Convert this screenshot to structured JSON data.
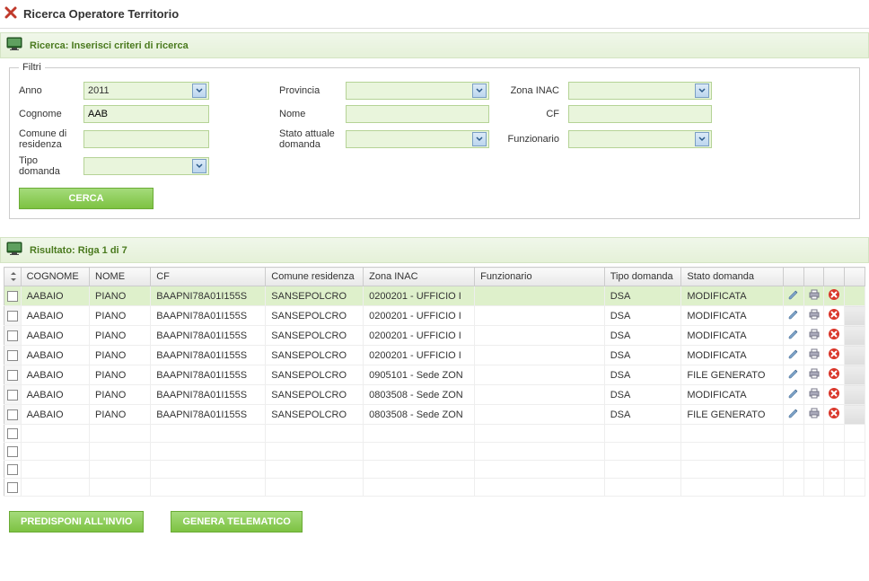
{
  "page": {
    "title": "Ricerca Operatore Territorio"
  },
  "search_section": {
    "title": "Ricerca: Inserisci criteri di ricerca"
  },
  "filters": {
    "legend": "Filtri",
    "anno": {
      "label": "Anno",
      "value": "2011"
    },
    "provincia": {
      "label": "Provincia",
      "value": ""
    },
    "zona_inac": {
      "label": "Zona INAC",
      "value": ""
    },
    "cognome": {
      "label": "Cognome",
      "value": "AAB"
    },
    "nome": {
      "label": "Nome",
      "value": ""
    },
    "cf": {
      "label": "CF",
      "value": ""
    },
    "comune_residenza": {
      "label": "Comune di residenza",
      "value": ""
    },
    "stato_attuale": {
      "label": "Stato attuale domanda",
      "value": ""
    },
    "funzionario": {
      "label": "Funzionario",
      "value": ""
    },
    "tipo_domanda": {
      "label": "Tipo domanda",
      "value": ""
    },
    "cerca_button": "CERCA"
  },
  "results_section": {
    "title": "Risultato: Riga 1 di 7"
  },
  "grid": {
    "columns": {
      "cognome": "COGNOME",
      "nome": "NOME",
      "cf": "CF",
      "comune": "Comune residenza",
      "zona": "Zona INAC",
      "funzionario": "Funzionario",
      "tipo": "Tipo domanda",
      "stato": "Stato domanda"
    },
    "rows": [
      {
        "cognome": "AABAIO",
        "nome": "PIANO",
        "cf": "BAAPNI78A01I155S",
        "comune": "SANSEPOLCRO",
        "zona": "0200201 - UFFICIO I",
        "funzionario": "",
        "tipo": "DSA",
        "stato": "MODIFICATA",
        "selected": true
      },
      {
        "cognome": "AABAIO",
        "nome": "PIANO",
        "cf": "BAAPNI78A01I155S",
        "comune": "SANSEPOLCRO",
        "zona": "0200201 - UFFICIO I",
        "funzionario": "",
        "tipo": "DSA",
        "stato": "MODIFICATA",
        "selected": false
      },
      {
        "cognome": "AABAIO",
        "nome": "PIANO",
        "cf": "BAAPNI78A01I155S",
        "comune": "SANSEPOLCRO",
        "zona": "0200201 - UFFICIO I",
        "funzionario": "",
        "tipo": "DSA",
        "stato": "MODIFICATA",
        "selected": false
      },
      {
        "cognome": "AABAIO",
        "nome": "PIANO",
        "cf": "BAAPNI78A01I155S",
        "comune": "SANSEPOLCRO",
        "zona": "0200201 - UFFICIO I",
        "funzionario": "",
        "tipo": "DSA",
        "stato": "MODIFICATA",
        "selected": false
      },
      {
        "cognome": "AABAIO",
        "nome": "PIANO",
        "cf": "BAAPNI78A01I155S",
        "comune": "SANSEPOLCRO",
        "zona": "0905101 - Sede ZON",
        "funzionario": "",
        "tipo": "DSA",
        "stato": "FILE GENERATO",
        "selected": false
      },
      {
        "cognome": "AABAIO",
        "nome": "PIANO",
        "cf": "BAAPNI78A01I155S",
        "comune": "SANSEPOLCRO",
        "zona": "0803508 - Sede ZON",
        "funzionario": "",
        "tipo": "DSA",
        "stato": "MODIFICATA",
        "selected": false
      },
      {
        "cognome": "AABAIO",
        "nome": "PIANO",
        "cf": "BAAPNI78A01I155S",
        "comune": "SANSEPOLCRO",
        "zona": "0803508 - Sede ZON",
        "funzionario": "",
        "tipo": "DSA",
        "stato": "FILE GENERATO",
        "selected": false
      }
    ],
    "empty_rows": 4
  },
  "actions": {
    "predisponi": "PREDISPONI ALL'INVIO",
    "genera": "GENERA TELEMATICO"
  },
  "icons": {
    "close": "close-icon",
    "monitor": "monitor-icon",
    "edit": "edit-icon",
    "print": "print-icon",
    "delete": "delete-icon"
  }
}
